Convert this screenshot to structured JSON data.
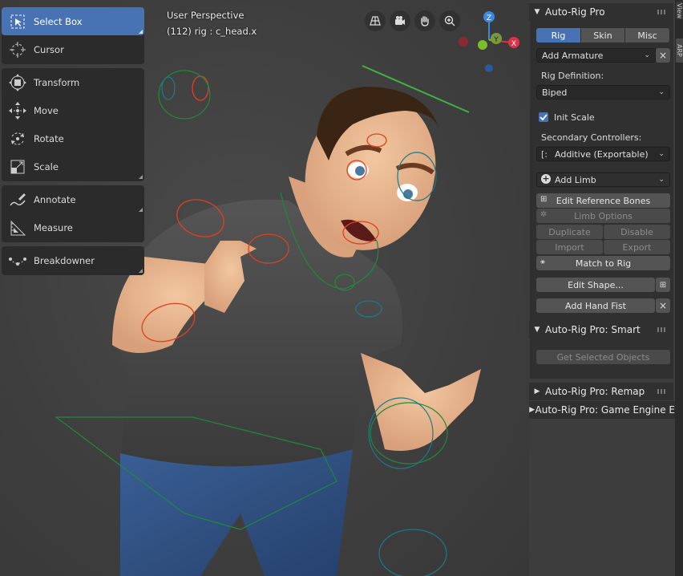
{
  "viewport": {
    "perspective_label": "User Perspective",
    "object_label": "(112) rig : c_head.x"
  },
  "toolbar": {
    "tools": [
      {
        "label": "Select Box",
        "icon": "select-box-icon"
      },
      {
        "label": "Cursor",
        "icon": "cursor-icon"
      },
      {
        "label": "Transform",
        "icon": "transform-icon"
      },
      {
        "label": "Move",
        "icon": "move-icon"
      },
      {
        "label": "Rotate",
        "icon": "rotate-icon"
      },
      {
        "label": "Scale",
        "icon": "scale-icon"
      },
      {
        "label": "Annotate",
        "icon": "annotate-icon"
      },
      {
        "label": "Measure",
        "icon": "measure-icon"
      },
      {
        "label": "Breakdowner",
        "icon": "breakdowner-icon"
      }
    ]
  },
  "gizmo": {
    "z": "Z",
    "y": "Y",
    "x": "X"
  },
  "panel": {
    "title": "Auto-Rig Pro",
    "tabs": [
      "Rig",
      "Skin",
      "Misc"
    ],
    "add_armature": "Add Armature",
    "rig_definition_label": "Rig Definition:",
    "rig_definition_value": "Biped",
    "init_scale_label": "Init Scale",
    "secondary_label": "Secondary Controllers:",
    "secondary_value": "Additive (Exportable)",
    "add_limb": "Add Limb",
    "edit_reference_bones": "Edit Reference Bones",
    "limb_options": "Limb Options",
    "duplicate": "Duplicate",
    "disable": "Disable",
    "import": "Import",
    "export": "Export",
    "match_to_rig": "Match to Rig",
    "edit_shape": "Edit Shape...",
    "add_hand_fist": "Add Hand Fist",
    "smart_title": "Auto-Rig Pro: Smart",
    "get_selected_objects": "Get Selected Objects",
    "remap_title": "Auto-Rig Pro: Remap",
    "game_engine_title": "Auto-Rig Pro: Game Engine E"
  },
  "side_tabs": [
    "View",
    "ARP"
  ],
  "colors": {
    "accent": "#4772b3",
    "axis_x": "#e0304a",
    "axis_y": "#7cbd2a",
    "axis_z": "#3a88e0"
  }
}
